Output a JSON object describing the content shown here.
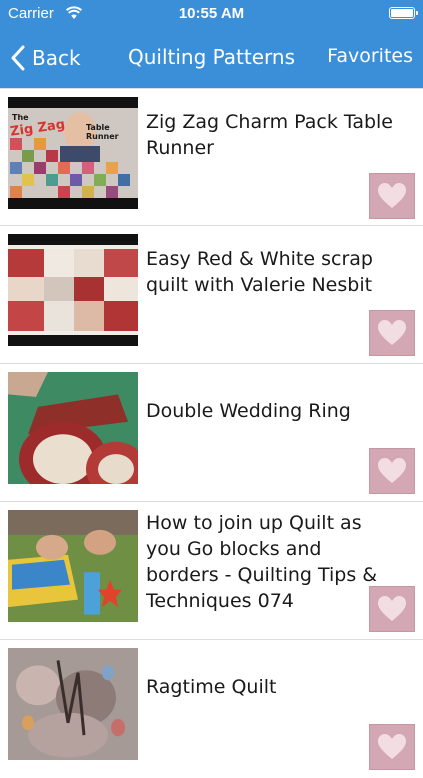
{
  "status_bar": {
    "carrier": "Carrier",
    "time": "10:55 AM"
  },
  "nav": {
    "back_label": "Back",
    "title": "Quilting Patterns",
    "favorites_label": "Favorites"
  },
  "colors": {
    "nav_bg": "#3a8fd8",
    "heart_bg": "#d4a7b4"
  },
  "videos": [
    {
      "title": "Zig Zag Charm Pack Table Runner",
      "thumb_text_1": "The",
      "thumb_text_2": "Zig Zag",
      "thumb_text_3": "Table Runner"
    },
    {
      "title": "Easy Red & White scrap quilt with Valerie Nesbit"
    },
    {
      "title": "Double Wedding Ring"
    },
    {
      "title": "How to join up Quilt as you Go blocks and borders - Quilting Tips & Techniques 074"
    },
    {
      "title": "Ragtime Quilt"
    }
  ]
}
